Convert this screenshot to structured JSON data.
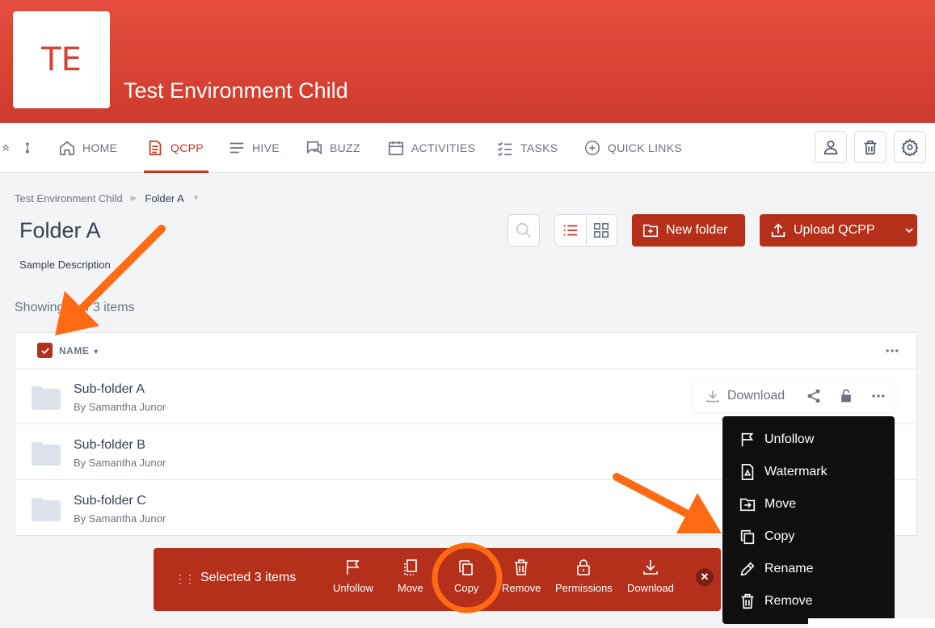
{
  "header": {
    "logo_text": "TE",
    "site_title": "Test Environment Child",
    "brand_color": "#d64230"
  },
  "nav": {
    "items": [
      {
        "label": "HOME",
        "icon": "home-icon"
      },
      {
        "label": "QCPP",
        "icon": "document-icon",
        "active": true
      },
      {
        "label": "HIVE",
        "icon": "lines-icon"
      },
      {
        "label": "BUZZ",
        "icon": "chat-icon"
      },
      {
        "label": "ACTIVITIES",
        "icon": "calendar-icon"
      },
      {
        "label": "TASKS",
        "icon": "checklist-icon"
      },
      {
        "label": "QUICK LINKS",
        "icon": "plus-circle-icon"
      }
    ]
  },
  "breadcrumb": {
    "root": "Test Environment Child",
    "current": "Folder A"
  },
  "page": {
    "title": "Folder A",
    "description": "Sample Description",
    "showing": "Showing 3 of 3 items"
  },
  "toolbar": {
    "new_folder_label": "New folder",
    "upload_label": "Upload QCPP"
  },
  "table": {
    "column_name": "NAME",
    "rows": [
      {
        "name": "Sub-folder A",
        "author": "By Samantha Junor"
      },
      {
        "name": "Sub-folder B",
        "author": "By Samantha Junor"
      },
      {
        "name": "Sub-folder C",
        "author": "By Samantha Junor"
      }
    ],
    "download_label": "Download"
  },
  "context_menu": {
    "items": [
      {
        "label": "Unfollow",
        "icon": "flag-icon"
      },
      {
        "label": "Watermark",
        "icon": "watermark-icon"
      },
      {
        "label": "Move",
        "icon": "move-icon"
      },
      {
        "label": "Copy",
        "icon": "copy-icon"
      },
      {
        "label": "Rename",
        "icon": "pencil-icon"
      },
      {
        "label": "Remove",
        "icon": "trash-icon"
      }
    ]
  },
  "bulk_bar": {
    "count_label": "Selected 3 items",
    "actions": [
      {
        "label": "Unfollow",
        "icon": "flag-icon"
      },
      {
        "label": "Move",
        "icon": "move-icon"
      },
      {
        "label": "Copy",
        "icon": "copy-icon"
      },
      {
        "label": "Remove",
        "icon": "trash-icon"
      },
      {
        "label": "Permissions",
        "icon": "lock-icon"
      },
      {
        "label": "Download",
        "icon": "download-icon"
      }
    ],
    "close_symbol": "✕"
  },
  "colors": {
    "accent": "#b5301b",
    "annotation": "#ff6a13"
  }
}
